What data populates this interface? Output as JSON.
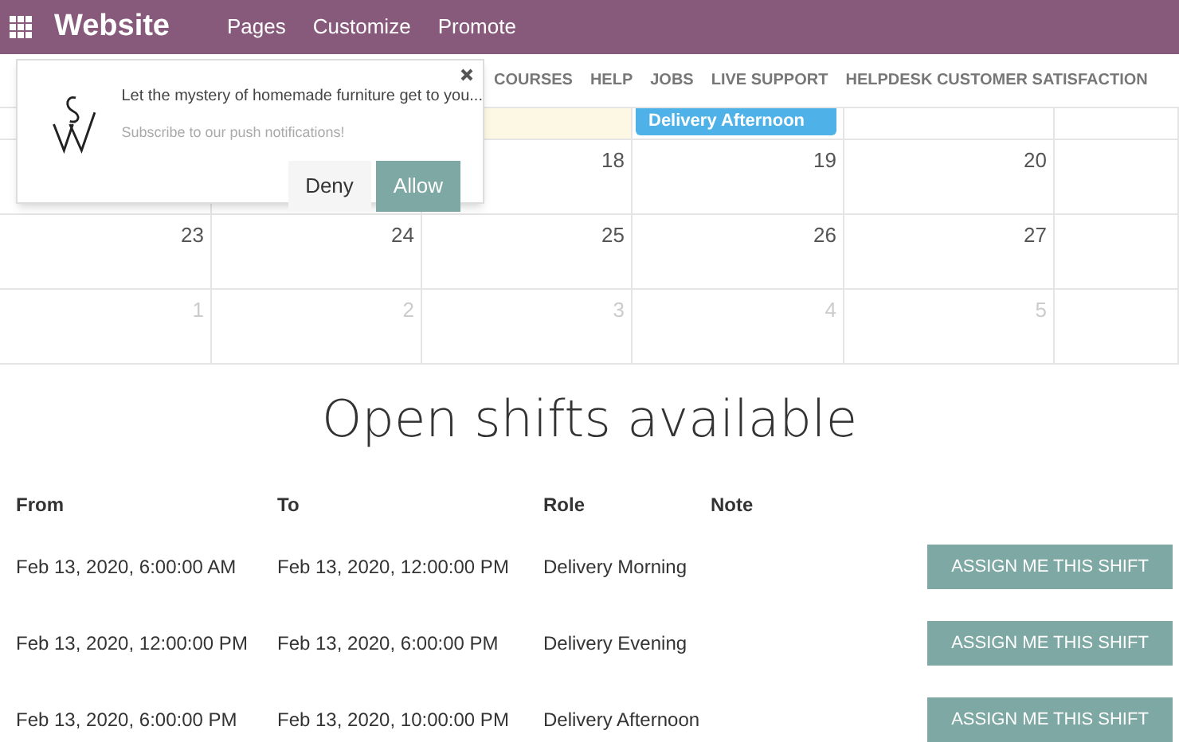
{
  "top_bar": {
    "app_name": "Website",
    "menu": [
      "Pages",
      "Customize",
      "Promote"
    ]
  },
  "nav": {
    "items": [
      "COURSES",
      "HELP",
      "JOBS",
      "LIVE SUPPORT",
      "HELPDESK CUSTOMER SATISFACTION"
    ]
  },
  "calendar": {
    "weeks": [
      {
        "cells": [
          {},
          {},
          {
            "today": true
          },
          {
            "today": false,
            "event": "Delivery Afternoon"
          },
          {
            "today": false
          },
          {
            "today": false
          }
        ]
      },
      {
        "cells": [
          {},
          {},
          {
            "day": "18",
            "muted": false
          },
          {
            "day": "19",
            "muted": false
          },
          {
            "day": "20",
            "muted": false
          },
          {}
        ]
      },
      {
        "cells": [
          {
            "day": "23",
            "muted": false
          },
          {
            "day": "24",
            "muted": false
          },
          {
            "day": "25",
            "muted": false
          },
          {
            "day": "26",
            "muted": false
          },
          {
            "day": "27",
            "muted": false
          },
          {}
        ]
      },
      {
        "cells": [
          {
            "day": "1",
            "muted": true
          },
          {
            "day": "2",
            "muted": true
          },
          {
            "day": "3",
            "muted": true
          },
          {
            "day": "4",
            "muted": true
          },
          {
            "day": "5",
            "muted": true
          },
          {}
        ]
      }
    ]
  },
  "heading": "Open shifts available",
  "shifts": {
    "columns": [
      "From",
      "To",
      "Role",
      "Note"
    ],
    "rows": [
      {
        "from": "Feb 13, 2020, 6:00:00 AM",
        "to": "Feb 13, 2020, 12:00:00 PM",
        "role": "Delivery Morning",
        "action": "ASSIGN ME THIS SHIFT"
      },
      {
        "from": "Feb 13, 2020, 12:00:00 PM",
        "to": "Feb 13, 2020, 6:00:00 PM",
        "role": "Delivery Evening",
        "action": "ASSIGN ME THIS SHIFT"
      },
      {
        "from": "Feb 13, 2020, 6:00:00 PM",
        "to": "Feb 13, 2020, 10:00:00 PM",
        "role": "Delivery Afternoon",
        "action": "ASSIGN ME THIS SHIFT"
      }
    ]
  },
  "notification": {
    "message": "Let the mystery of homemade furniture get to you...",
    "subtitle": "Subscribe to our push notifications!",
    "buttons": [
      "Deny",
      "Allow"
    ]
  }
}
